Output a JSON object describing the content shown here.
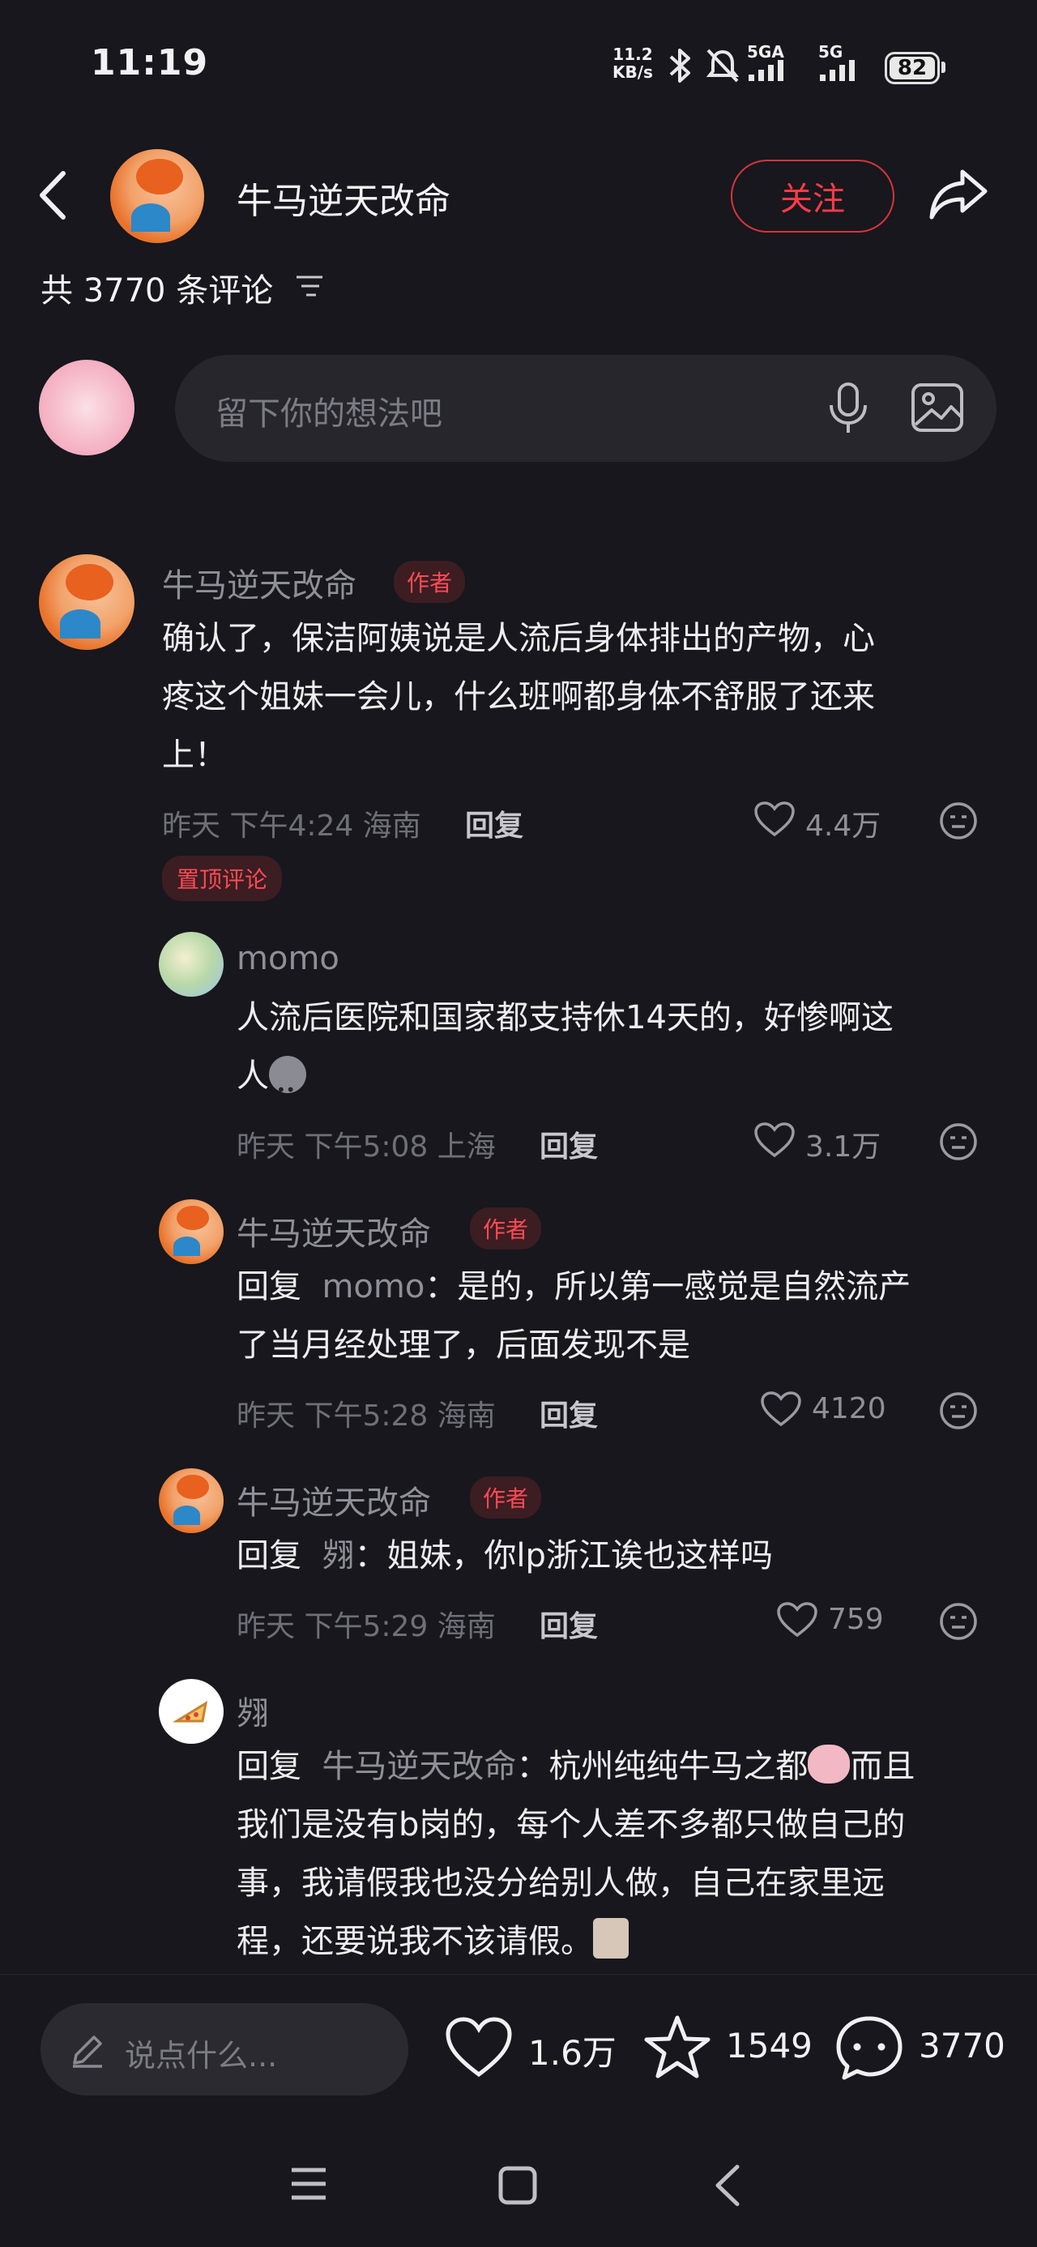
{
  "status_bar": {
    "time": "11:19",
    "net_speed_value": "11.2",
    "net_speed_unit": "KB/s",
    "signal1_label": "5GA",
    "signal2_label": "5G",
    "battery": "82"
  },
  "header": {
    "username": "牛马逆天改命",
    "follow_label": "关注"
  },
  "comments_header": {
    "count_text": "共 3770 条评论"
  },
  "input": {
    "placeholder": "留下你的想法吧"
  },
  "comments": [
    {
      "name": "牛马逆天改命",
      "tag": "作者",
      "line1": "确认了，保洁阿姨说是人流后身体排出的产物，心",
      "line2": "疼这个姐妹一会儿，什么班啊都身体不舒服了还来",
      "line3": "上！",
      "meta": "昨天  下午4:24 海南",
      "reply_label": "回复",
      "likes": "4.4万",
      "pinned": "置顶评论"
    },
    {
      "name": "momo",
      "line1": "人流后医院和国家都支持休14天的，好惨啊这",
      "line2": "人",
      "meta": "昨天  下午5:08 上海",
      "reply_label": "回复",
      "likes": "3.1万"
    },
    {
      "name": "牛马逆天改命",
      "tag": "作者",
      "reply_prefix": "回复",
      "reply_to": "momo",
      "line1": "：是的，所以第一感觉是自然流产",
      "line2": "了当月经处理了，后面发现不是",
      "meta": "昨天  下午5:28 海南",
      "reply_label": "回复",
      "likes": "4120"
    },
    {
      "name": "牛马逆天改命",
      "tag": "作者",
      "reply_prefix": "回复",
      "reply_to": "翙",
      "line1": "：姐妹，你lp浙江诶也这样吗",
      "meta": "昨天  下午5:29 海南",
      "reply_label": "回复",
      "likes": "759"
    },
    {
      "name": "翙",
      "reply_prefix": "回复",
      "reply_to": "牛马逆天改命",
      "line1": "：杭州纯纯牛马之都",
      "line1b": "而且",
      "line2": "我们是没有b岗的，每个人差不多都只做自己的",
      "line3": "事，我请假我也没分给别人做，自己在家里远",
      "line4": "程，还要说我不该请假。"
    }
  ],
  "bottom_bar": {
    "placeholder": "说点什么...",
    "likes": "1.6万",
    "favorites": "1549",
    "comments": "3770"
  },
  "icons": {
    "back": "back-arrow-icon",
    "share": "share-icon",
    "filter": "filter-icon",
    "mic": "microphone-icon",
    "image": "image-icon",
    "heart": "heart-icon",
    "emoji": "emoji-icon",
    "star": "star-icon",
    "comment": "comment-icon",
    "pencil": "pencil-icon"
  },
  "colors": {
    "background": "#17171d",
    "accent_red": "#ff3b47",
    "muted_text": "#8f8f97"
  }
}
